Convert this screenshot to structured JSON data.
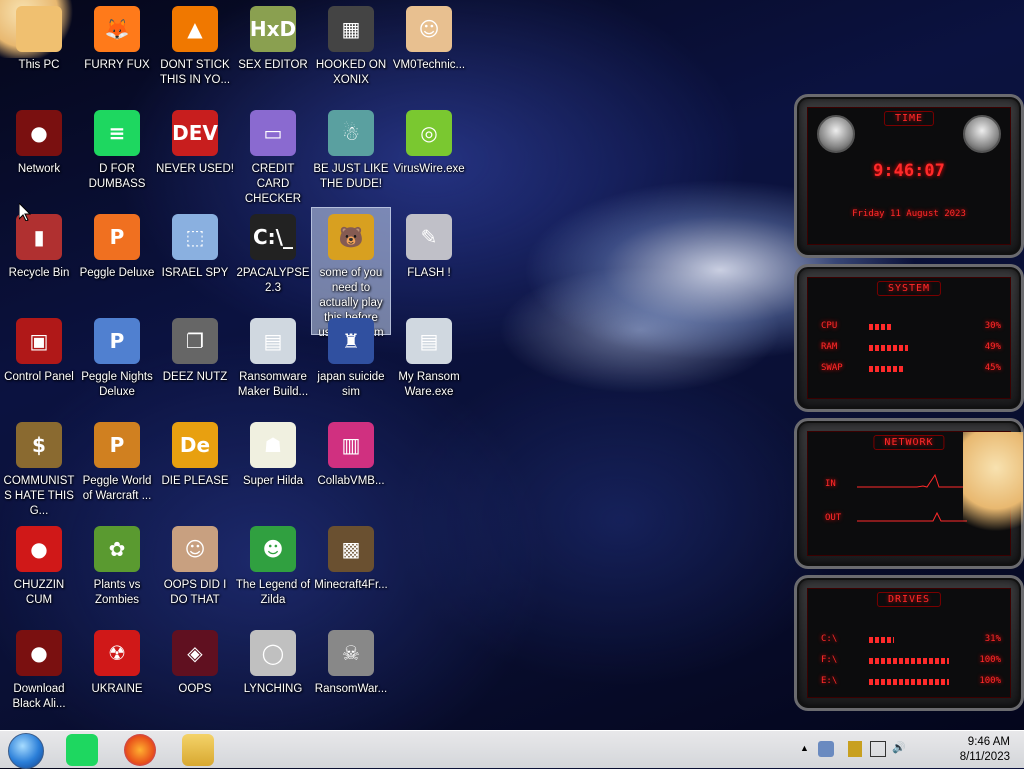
{
  "desktop": {
    "icons": [
      {
        "label": "This PC",
        "glyph": "",
        "color": "#f0c070"
      },
      {
        "label": "FURRY FUX",
        "glyph": "🦊",
        "color": "#ff7a1a"
      },
      {
        "label": "DONT STICK THIS IN YO...",
        "glyph": "▲",
        "color": "#f07800"
      },
      {
        "label": "SEX EDITOR",
        "glyph": "HxD",
        "color": "#8aa050"
      },
      {
        "label": "HOOKED ON XONIX",
        "glyph": "▦",
        "color": "#444"
      },
      {
        "label": "VM0Technic...",
        "glyph": "☺",
        "color": "#e8c090"
      },
      {
        "label": "Network",
        "glyph": "●",
        "color": "#7a1010"
      },
      {
        "label": "D FOR DUMBASS",
        "glyph": "≡",
        "color": "#1ed760"
      },
      {
        "label": "NEVER USED!",
        "glyph": "DEV",
        "color": "#c81e1e"
      },
      {
        "label": "CREDIT CARD CHECKER",
        "glyph": "▭",
        "color": "#8a6ad0"
      },
      {
        "label": "BE JUST LIKE THE DUDE!",
        "glyph": "☃",
        "color": "#5aa0a0"
      },
      {
        "label": "VirusWire.exe",
        "glyph": "◎",
        "color": "#7ac830"
      },
      {
        "label": "Recycle Bin",
        "glyph": "▮",
        "color": "#b03030"
      },
      {
        "label": "Peggle Deluxe",
        "glyph": "P",
        "color": "#f07020"
      },
      {
        "label": "ISRAEL SPY",
        "glyph": "⬚",
        "color": "#8ab0e0"
      },
      {
        "label": "2PACALYPSE 2.3",
        "glyph": "C:\\_",
        "color": "#222"
      },
      {
        "label": "some of you need to actually play this before using the vm",
        "glyph": "🐻",
        "color": "#d8a020"
      },
      {
        "label": "FLASH !",
        "glyph": "✎",
        "color": "#c0c0c8"
      },
      {
        "label": "Control Panel",
        "glyph": "▣",
        "color": "#b01818"
      },
      {
        "label": "Peggle Nights Deluxe",
        "glyph": "P",
        "color": "#5080d0"
      },
      {
        "label": "DEEZ NUTZ",
        "glyph": "❐",
        "color": "#666"
      },
      {
        "label": "Ransomware Maker Build...",
        "glyph": "▤",
        "color": "#d0d8e0"
      },
      {
        "label": "japan suicide sim",
        "glyph": "♜",
        "color": "#3050a0"
      },
      {
        "label": "My Ransom Ware.exe",
        "glyph": "▤",
        "color": "#d0d8e0"
      },
      {
        "label": "COMMUNISTS HATE THIS G...",
        "glyph": "$",
        "color": "#8a6a30"
      },
      {
        "label": "Peggle World of Warcraft ...",
        "glyph": "P",
        "color": "#d08020"
      },
      {
        "label": "DIE PLEASE",
        "glyph": "De",
        "color": "#e8a010"
      },
      {
        "label": "Super Hilda",
        "glyph": "☗",
        "color": "#f0f0e0"
      },
      {
        "label": "CollabVMB...",
        "glyph": "▥",
        "color": "#d03080"
      },
      {
        "label": "",
        "glyph": "",
        "color": "transparent"
      },
      {
        "label": "CHUZZIN CUM",
        "glyph": "●",
        "color": "#d01818"
      },
      {
        "label": "Plants vs Zombies",
        "glyph": "✿",
        "color": "#5a9a30"
      },
      {
        "label": "OOPS DID I DO THAT",
        "glyph": "☺",
        "color": "#c8a080"
      },
      {
        "label": "The Legend of Zilda",
        "glyph": "☻",
        "color": "#30a040"
      },
      {
        "label": "Minecraft4Fr...",
        "glyph": "▩",
        "color": "#6a5030"
      },
      {
        "label": "",
        "glyph": "",
        "color": "transparent"
      },
      {
        "label": "Download Black Ali...",
        "glyph": "●",
        "color": "#7a1010"
      },
      {
        "label": "UKRAINE",
        "glyph": "☢",
        "color": "#d01818"
      },
      {
        "label": "OOPS",
        "glyph": "◈",
        "color": "#601020"
      },
      {
        "label": "LYNCHING",
        "glyph": "◯",
        "color": "#c0c0c0"
      },
      {
        "label": "RansomWar...",
        "glyph": "☠",
        "color": "#888"
      },
      {
        "label": "",
        "glyph": "",
        "color": "transparent"
      }
    ]
  },
  "widget": {
    "time": {
      "title": "TIME",
      "clock": "9:46:07",
      "date": "Friday 11 August 2023"
    },
    "system": {
      "title": "SYSTEM",
      "rows": [
        {
          "label": "CPU",
          "value": "30%",
          "fill": 0.3
        },
        {
          "label": "RAM",
          "value": "49%",
          "fill": 0.49
        },
        {
          "label": "SWAP",
          "value": "45%",
          "fill": 0.45
        }
      ]
    },
    "network": {
      "title": "NETWORK",
      "in_label": "IN",
      "out_label": "OUT"
    },
    "drives": {
      "title": "DRIVES",
      "rows": [
        {
          "label": "C:\\",
          "value": "31%",
          "fill": 0.31
        },
        {
          "label": "F:\\",
          "value": "100%",
          "fill": 1.0
        },
        {
          "label": "E:\\",
          "value": "100%",
          "fill": 1.0
        }
      ]
    }
  },
  "taskbar": {
    "clock_time": "9:46 AM",
    "clock_date": "8/11/2023",
    "tray_chevron": "▲"
  }
}
